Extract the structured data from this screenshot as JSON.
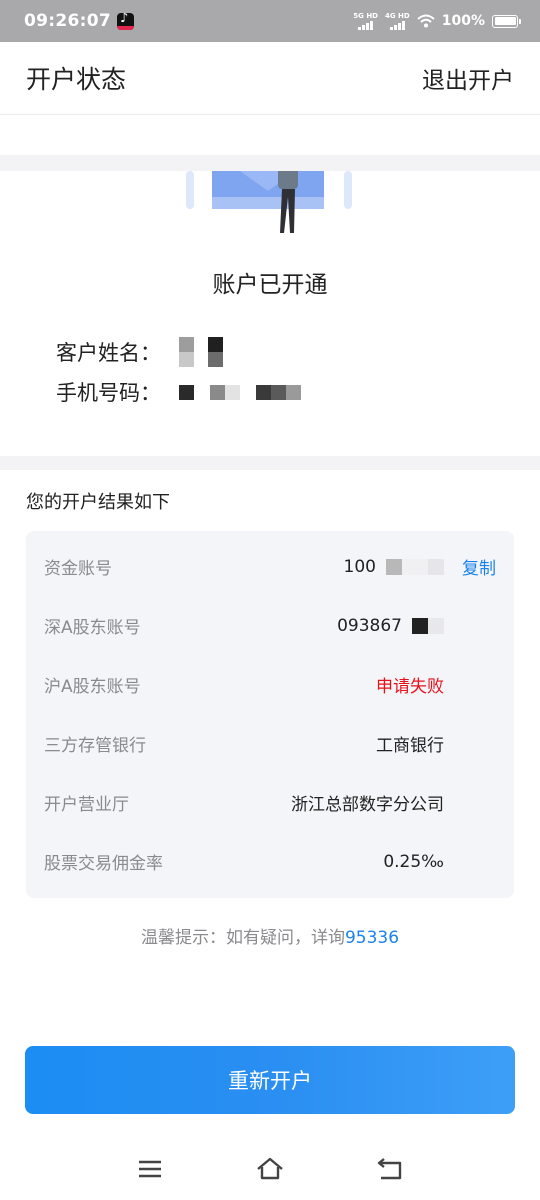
{
  "status_bar": {
    "time": "09:26:07",
    "network1": "5G HD",
    "network2": "4G HD",
    "battery": "100%"
  },
  "header": {
    "title": "开户状态",
    "exit_label": "退出开户"
  },
  "account": {
    "status_text": "账户已开通",
    "name_label": "客户姓名：",
    "phone_label": "手机号码："
  },
  "result": {
    "title": "您的开户结果如下",
    "rows": [
      {
        "label": "资金账号",
        "value": "100",
        "action": "复制"
      },
      {
        "label": "深A股东账号",
        "value": "093867"
      },
      {
        "label": "沪A股东账号",
        "value": "申请失败"
      },
      {
        "label": "三方存管银行",
        "value": "工商银行"
      },
      {
        "label": "开户营业厅",
        "value": "浙江总部数字分公司"
      },
      {
        "label": "股票交易佣金率",
        "value": "0.25‰"
      }
    ]
  },
  "tip": {
    "text": "温馨提示：如有疑问，详询",
    "phone": "95336"
  },
  "reopen_button": "重新开户",
  "colors": {
    "primary": "#1a82ef",
    "error": "#e8111b",
    "card_bg": "#f4f5f8"
  }
}
